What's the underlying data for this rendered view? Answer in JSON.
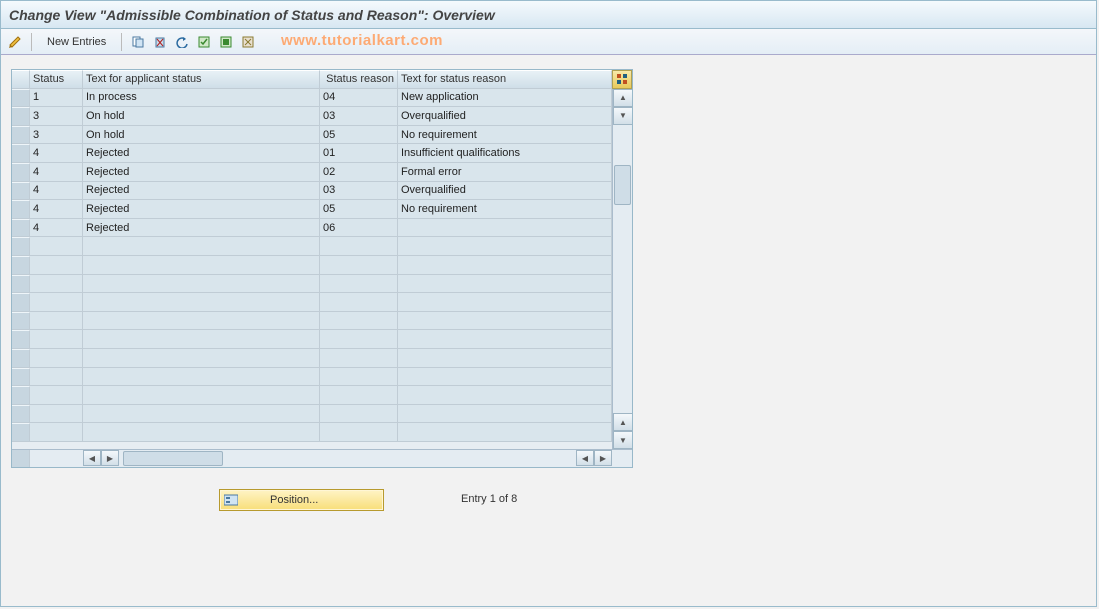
{
  "title": "Change View \"Admissible Combination of Status and Reason\": Overview",
  "toolbar": {
    "new_entries_label": "New Entries"
  },
  "watermark": "www.tutorialkart.com",
  "columns": {
    "status": "Status",
    "text_applicant": "Text for applicant status",
    "status_reason": "Status reason",
    "text_reason": "Text for status reason"
  },
  "rows": [
    {
      "status": "1",
      "text_applicant": "In process",
      "status_reason": "04",
      "text_reason": "New application"
    },
    {
      "status": "3",
      "text_applicant": "On hold",
      "status_reason": "03",
      "text_reason": "Overqualified"
    },
    {
      "status": "3",
      "text_applicant": "On hold",
      "status_reason": "05",
      "text_reason": "No requirement"
    },
    {
      "status": "4",
      "text_applicant": "Rejected",
      "status_reason": "01",
      "text_reason": "Insufficient qualifications"
    },
    {
      "status": "4",
      "text_applicant": "Rejected",
      "status_reason": "02",
      "text_reason": "Formal error"
    },
    {
      "status": "4",
      "text_applicant": "Rejected",
      "status_reason": "03",
      "text_reason": "Overqualified"
    },
    {
      "status": "4",
      "text_applicant": "Rejected",
      "status_reason": "05",
      "text_reason": "No requirement"
    },
    {
      "status": "4",
      "text_applicant": "Rejected",
      "status_reason": "06",
      "text_reason": ""
    }
  ],
  "blank_rows": 11,
  "position_button": "Position...",
  "entry_counter": "Entry 1 of 8"
}
